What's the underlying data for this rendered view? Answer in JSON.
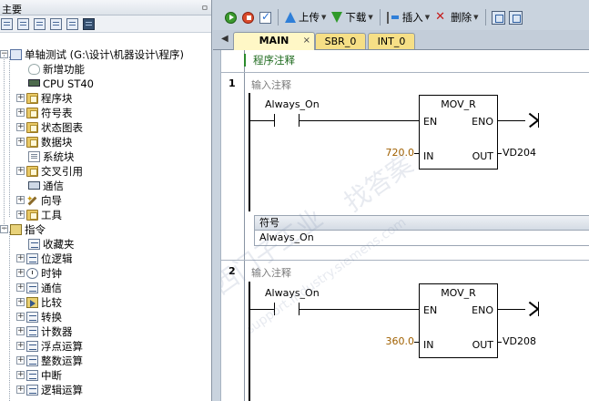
{
  "left_pane": {
    "title": "主要",
    "pin_glyph": "ㅁ",
    "toolbar_icons": [
      "project-view-icon",
      "list-icon",
      "document-icon",
      "document-icon",
      "table-icon",
      "monitor-icon"
    ],
    "tree": [
      {
        "label": "单轴测试 (G:\\设计\\机器设计\\程序)",
        "icon": "root",
        "level": 0,
        "expander": "-"
      },
      {
        "label": "新增功能",
        "icon": "bulb",
        "level": 1,
        "expander": ""
      },
      {
        "label": "CPU ST40",
        "icon": "cpu",
        "level": 1,
        "expander": ""
      },
      {
        "label": "程序块",
        "icon": "folder",
        "level": 1,
        "expander": "+"
      },
      {
        "label": "符号表",
        "icon": "folder",
        "level": 1,
        "expander": "+"
      },
      {
        "label": "状态图表",
        "icon": "folder",
        "level": 1,
        "expander": "+"
      },
      {
        "label": "数据块",
        "icon": "folder",
        "level": 1,
        "expander": "+"
      },
      {
        "label": "系统块",
        "icon": "doc",
        "level": 1,
        "expander": ""
      },
      {
        "label": "交叉引用",
        "icon": "folder",
        "level": 1,
        "expander": "+"
      },
      {
        "label": "通信",
        "icon": "net",
        "level": 1,
        "expander": ""
      },
      {
        "label": "向导",
        "icon": "wiz",
        "level": 1,
        "expander": "+"
      },
      {
        "label": "工具",
        "icon": "folder",
        "level": 1,
        "expander": "+"
      },
      {
        "label": "指令",
        "icon": "instr",
        "level": 0,
        "expander": "-"
      },
      {
        "label": "收藏夹",
        "icon": "leaf",
        "level": 1,
        "expander": ""
      },
      {
        "label": "位逻辑",
        "icon": "leaf",
        "level": 1,
        "expander": "+"
      },
      {
        "label": "时钟",
        "icon": "clock",
        "level": 1,
        "expander": "+"
      },
      {
        "label": "通信",
        "icon": "leaf",
        "level": 1,
        "expander": "+"
      },
      {
        "label": "比较",
        "icon": "cmp",
        "level": 1,
        "expander": "+"
      },
      {
        "label": "转换",
        "icon": "leaf",
        "level": 1,
        "expander": "+"
      },
      {
        "label": "计数器",
        "icon": "leaf",
        "level": 1,
        "expander": "+"
      },
      {
        "label": "浮点运算",
        "icon": "leaf",
        "level": 1,
        "expander": "+"
      },
      {
        "label": "整数运算",
        "icon": "leaf",
        "level": 1,
        "expander": "+"
      },
      {
        "label": "中断",
        "icon": "leaf",
        "level": 1,
        "expander": "+"
      },
      {
        "label": "逻辑运算",
        "icon": "leaf",
        "level": 1,
        "expander": "+"
      }
    ]
  },
  "toolbar": {
    "upload_label": "上传",
    "download_label": "下载",
    "insert_label": "插入",
    "delete_label": "删除"
  },
  "tabs": [
    {
      "label": "MAIN",
      "active": true,
      "close": "×"
    },
    {
      "label": "SBR_0",
      "active": false
    },
    {
      "label": "INT_0",
      "active": false
    }
  ],
  "tabs_nav": "◀",
  "editor": {
    "program_comment": "程序注释",
    "networks": [
      {
        "number": "1",
        "comment": "输入注释",
        "contact": "Always_On",
        "box_name": "MOV_R",
        "en": "EN",
        "eno": "ENO",
        "in_pin": "IN",
        "out_pin": "OUT",
        "in_value": "720.0",
        "out_value": "VD204",
        "symbol_header": "符号",
        "symbol_row": "Always_On"
      },
      {
        "number": "2",
        "comment": "输入注释",
        "contact": "Always_On",
        "box_name": "MOV_R",
        "en": "EN",
        "eno": "ENO",
        "in_pin": "IN",
        "out_pin": "OUT",
        "in_value": "360.0",
        "out_value": "VD208"
      }
    ]
  },
  "watermark": {
    "text1": "西门子工业",
    "text2": "support.industry.siemens.com",
    "text3": "找答案"
  }
}
